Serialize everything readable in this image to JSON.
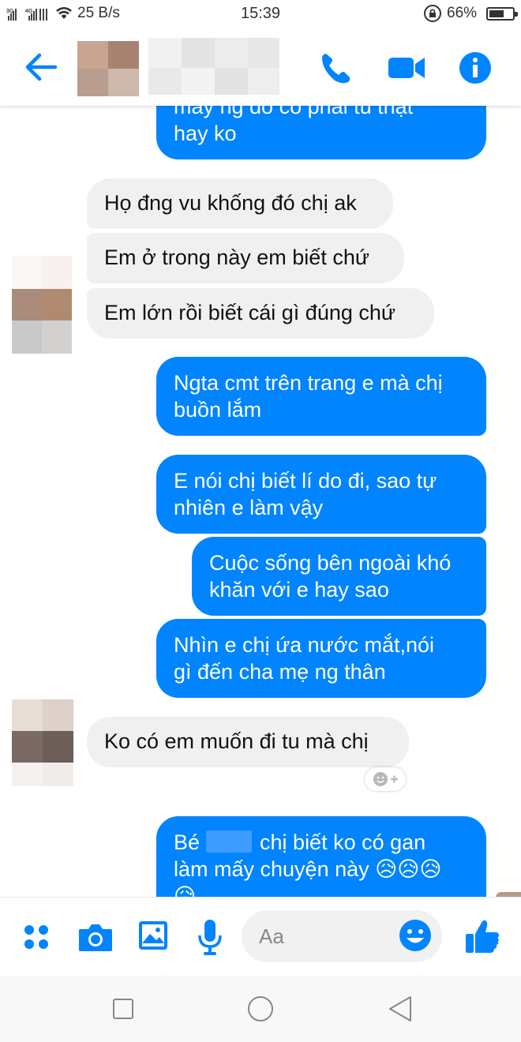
{
  "status_bar": {
    "signal_text": "3G 4G",
    "speed": "25 B/s",
    "time": "15:39",
    "battery": "66%",
    "battery_level": 0.66
  },
  "header": {
    "back_icon": "back-arrow-icon",
    "call_icon": "phone-icon",
    "video_icon": "video-camera-icon",
    "info_icon": "info-icon",
    "accent_color": "#0084ff"
  },
  "messages": [
    {
      "id": "m1",
      "side": "out",
      "lines": [
        "mày ng đó có phải tù thật",
        "hay ko"
      ]
    },
    {
      "id": "m2",
      "side": "in",
      "lines": [
        "Họ đng vu khống đó chị ak"
      ]
    },
    {
      "id": "m3",
      "side": "in",
      "lines": [
        "Em ở trong này em biết chứ"
      ]
    },
    {
      "id": "m4",
      "side": "in",
      "lines": [
        "Em lớn rồi biết cái gì đúng chứ"
      ]
    },
    {
      "id": "m5",
      "side": "out",
      "lines": [
        "Ngta cmt trên trang e mà chị",
        "buồn lắm"
      ]
    },
    {
      "id": "m6",
      "side": "out",
      "lines": [
        "E nói chị biết lí do đi, sao tự",
        "nhiên e làm vậy"
      ]
    },
    {
      "id": "m7",
      "side": "out",
      "lines": [
        "Cuộc sống bên ngoài khó",
        "khăn với e hay sao"
      ]
    },
    {
      "id": "m8",
      "side": "out",
      "lines": [
        "Nhìn e chị ứa nước mắt,nói",
        "gì đến cha mẹ ng thân"
      ]
    },
    {
      "id": "m9",
      "side": "in",
      "lines": [
        "Ko có em muốn đi tu mà chị"
      ]
    },
    {
      "id": "m10",
      "side": "out",
      "lines": [
        "Bé",
        "chị biết ko có gan",
        "làm mấy chuyện này 😥😥😥",
        "😥"
      ]
    }
  ],
  "composer": {
    "placeholder": "Aa",
    "apps_icon": "apps-grid-icon",
    "camera_icon": "camera-icon",
    "gallery_icon": "image-icon",
    "mic_icon": "microphone-icon",
    "emoji_icon": "smiley-icon",
    "like_icon": "thumbs-up-icon"
  },
  "navbar": {
    "recents_icon": "square-icon",
    "home_icon": "circle-icon",
    "back_icon": "triangle-back-icon"
  },
  "colors": {
    "outgoing_bubble": "#0084ff",
    "incoming_bubble": "#f1f0f0",
    "icon_blue": "#0084ff"
  }
}
